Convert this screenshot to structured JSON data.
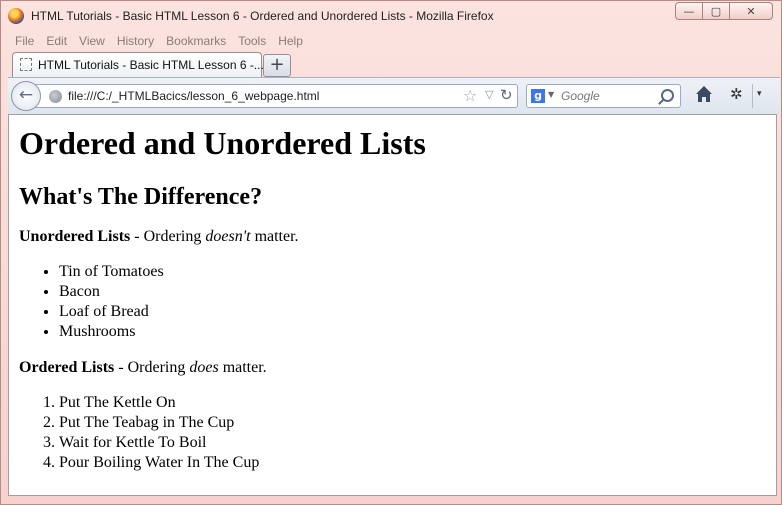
{
  "window": {
    "title": "HTML Tutorials - Basic HTML Lesson 6 - Ordered and Unordered Lists - Mozilla Firefox",
    "controls": {
      "minimize": "—",
      "maximize": "▢",
      "close": "✕"
    }
  },
  "menubar": {
    "items": [
      {
        "label": "File"
      },
      {
        "label": "Edit"
      },
      {
        "label": "View"
      },
      {
        "label": "History"
      },
      {
        "label": "Bookmarks"
      },
      {
        "label": "Tools"
      },
      {
        "label": "Help"
      }
    ]
  },
  "tabs": {
    "active_label": "HTML Tutorials - Basic HTML Lesson 6 -...",
    "new_tab_label": "+"
  },
  "navbar": {
    "back_glyph": "←",
    "url": "file:///C:/_HTMLBacics/lesson_6_webpage.html",
    "star_glyph": "☆",
    "dropdown_glyph": "▽",
    "reload_glyph": "↻",
    "search_engine_letter": "g",
    "search_placeholder": "Google",
    "addon_glyph": "✲",
    "menu_caret": "▾"
  },
  "page": {
    "heading1": "Ordered and Unordered Lists",
    "heading2": "What's The Difference?",
    "unordered_intro": {
      "bold": "Unordered Lists",
      "before_em": " - Ordering ",
      "em": "doesn't",
      "after_em": " matter."
    },
    "unordered_items": [
      "Tin of Tomatoes",
      "Bacon",
      "Loaf of Bread",
      "Mushrooms"
    ],
    "ordered_intro": {
      "bold": "Ordered Lists",
      "before_em": " - Ordering ",
      "em": "does",
      "after_em": " matter."
    },
    "ordered_items": [
      "Put The Kettle On",
      "Put The Teabag in The Cup",
      "Wait for Kettle To Boil",
      "Pour Boiling Water In The Cup"
    ]
  },
  "colors": {
    "window_frame": "#f5d2cd",
    "navbar": "#dfe5ee",
    "content_bg": "#ffffff"
  }
}
